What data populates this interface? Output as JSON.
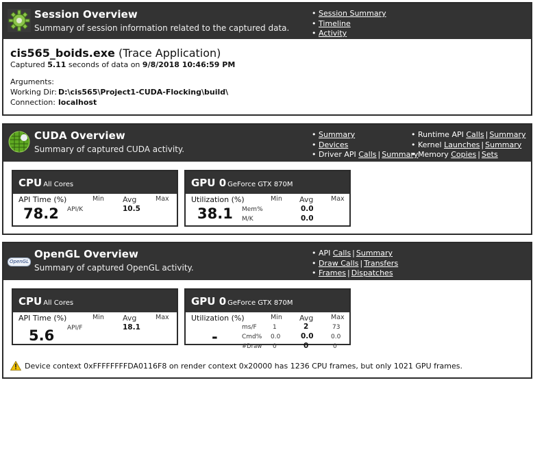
{
  "session": {
    "title": "Session Overview",
    "subtitle": "Summary of session information related to the captured data.",
    "links": [
      "Session Summary",
      "Timeline",
      "Activity"
    ],
    "app_name": "cis565_boids.exe",
    "app_type": "(Trace Application)",
    "captured_prefix": "Captured",
    "captured_seconds": "5.11",
    "captured_mid": "seconds of data on",
    "captured_datetime": "9/8/2018 10:46:59 PM",
    "arguments_label": "Arguments:",
    "workdir_label": "Working Dir:",
    "workdir_value": "D:\\cis565\\Project1-CUDA-Flocking\\build\\",
    "connection_label": "Connection:",
    "connection_value": "localhost"
  },
  "cuda": {
    "title": "CUDA Overview",
    "subtitle": "Summary of captured CUDA activity.",
    "links_left": {
      "summary": "Summary",
      "devices": "Devices",
      "driver_prefix": "Driver API",
      "driver_calls": "Calls",
      "driver_summary": "Summary"
    },
    "links_right": {
      "runtime_prefix": "Runtime API",
      "runtime_calls": "Calls",
      "runtime_summary": "Summary",
      "kernel_prefix": "Kernel",
      "kernel_launches": "Launches",
      "kernel_summary": "Summary",
      "memory_prefix": "Memory",
      "memory_copies": "Copies",
      "memory_sets": "Sets"
    },
    "cpu": {
      "name": "CPU",
      "sub": "All Cores",
      "metric_label": "API Time (%)",
      "min": "Min",
      "avg": "Avg",
      "max": "Max",
      "big": "78.2",
      "row_label": "API/K",
      "row_avg": "10.5"
    },
    "gpu": {
      "name": "GPU 0",
      "sub": "GeForce GTX 870M",
      "metric_label": "Utilization (%)",
      "min": "Min",
      "avg": "Avg",
      "max": "Max",
      "big": "38.1",
      "row1_label": "Mem%",
      "row1_avg": "0.0",
      "row2_label": "M/K",
      "row2_avg": "0.0"
    }
  },
  "opengl": {
    "title": "OpenGL Overview",
    "subtitle": "Summary of captured OpenGL activity.",
    "logo_text": "OpenGL",
    "links": {
      "api_prefix": "API",
      "api_calls": "Calls",
      "api_summary": "Summary",
      "draw_calls": "Draw Calls",
      "transfers": "Transfers",
      "frames": "Frames",
      "dispatches": "Dispatches"
    },
    "cpu": {
      "name": "CPU",
      "sub": "All Cores",
      "metric_label": "API Time (%)",
      "min": "Min",
      "avg": "Avg",
      "max": "Max",
      "big": "5.6",
      "row_label": "API/F",
      "row_avg": "18.1"
    },
    "gpu": {
      "name": "GPU 0",
      "sub": "GeForce GTX 870M",
      "metric_label": "Utilization (%)",
      "min": "Min",
      "avg": "Avg",
      "max": "Max",
      "big": "-",
      "rows": [
        {
          "label": "ms/F",
          "min": "1",
          "avg": "2",
          "max": "73"
        },
        {
          "label": "Cmd%",
          "min": "0.0",
          "avg": "0.0",
          "max": "0.0"
        },
        {
          "label": "#Draw",
          "min": "0",
          "avg": "0",
          "max": "0"
        }
      ]
    },
    "warning": "Device context 0xFFFFFFFFDA0116F8 on render context 0x20000 has 1236 CPU frames, but only 1021 GPU frames."
  },
  "colors": {
    "header_bg": "#333333",
    "border": "#2b2b2b",
    "warning": "#f2c200"
  }
}
